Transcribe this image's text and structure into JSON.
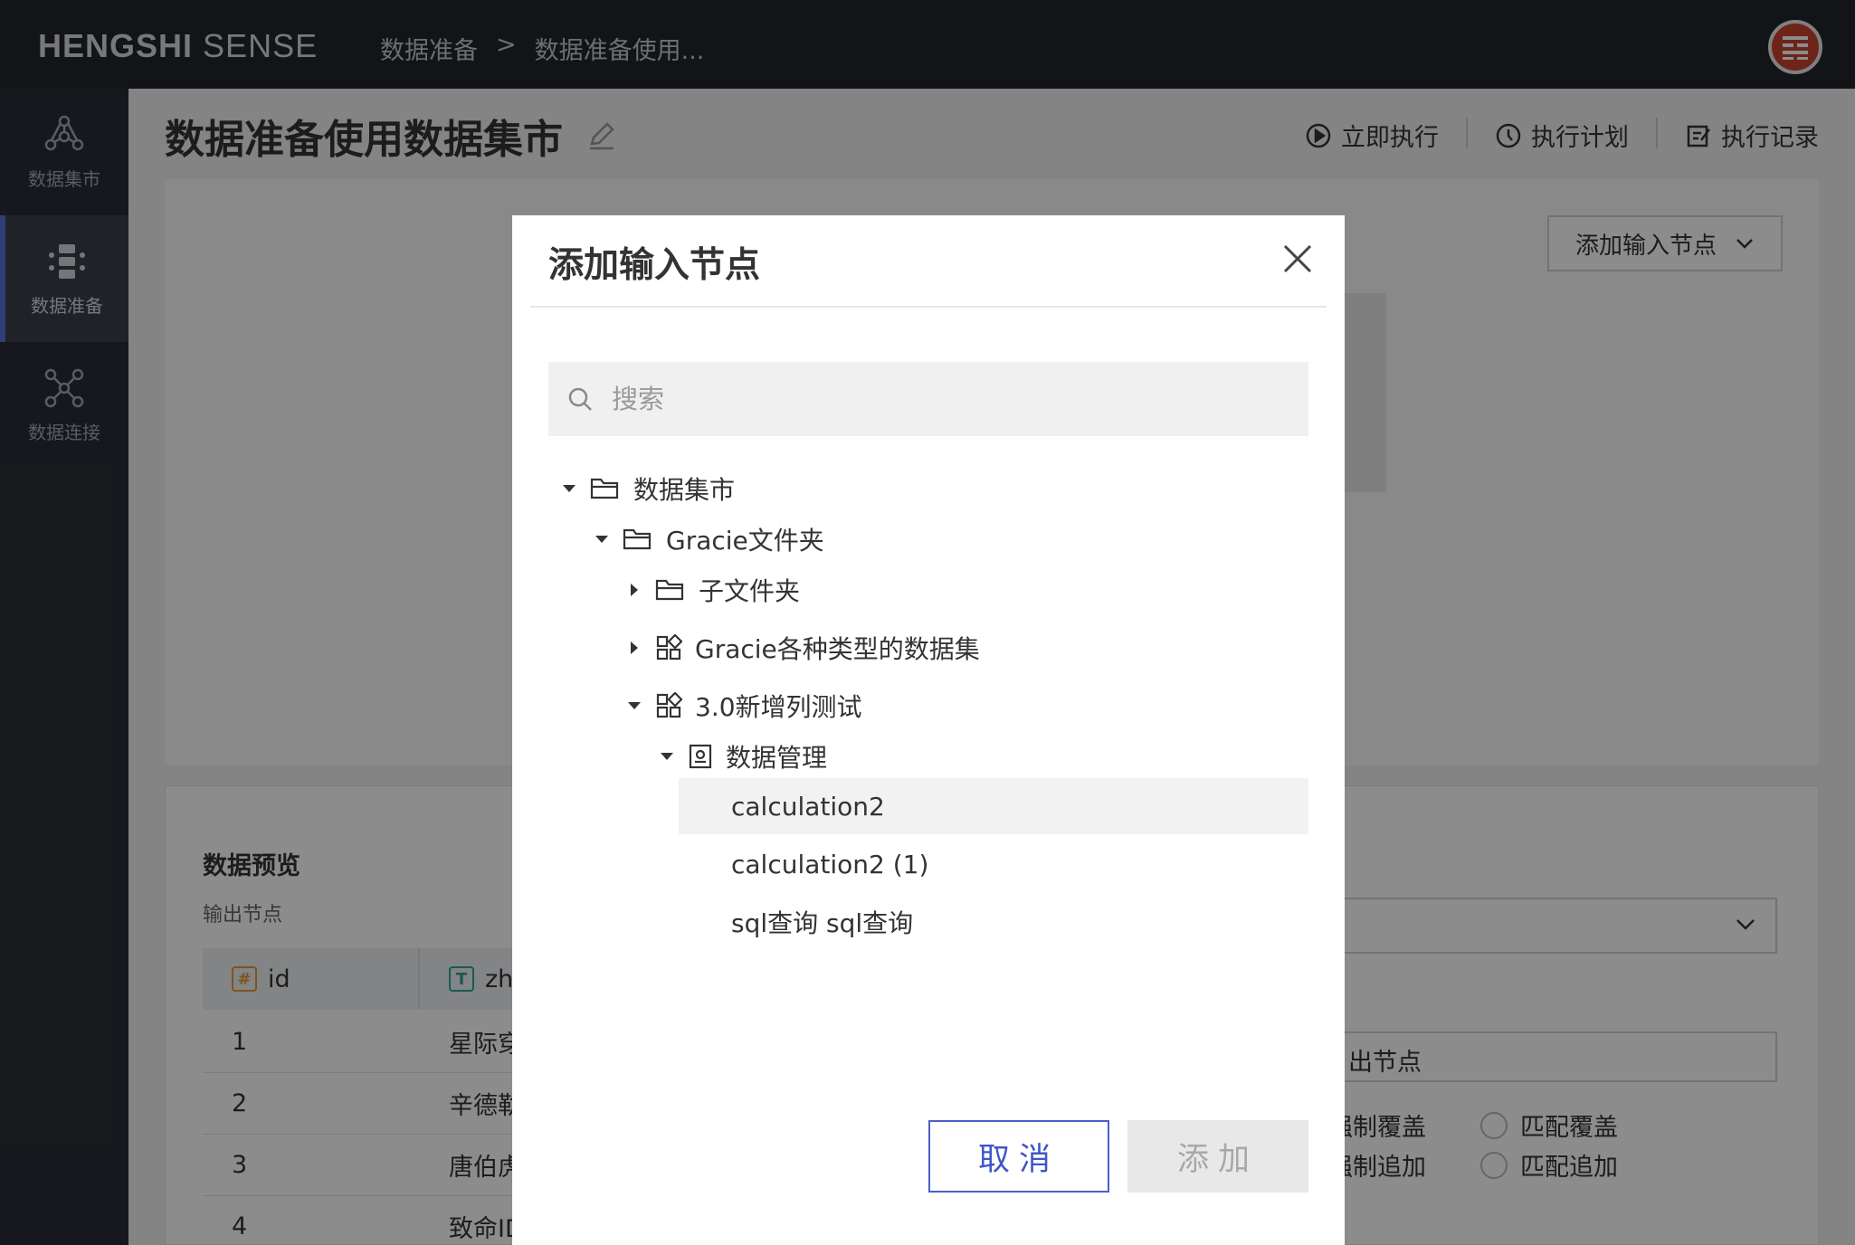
{
  "header": {
    "brand_bold": "HENGSHI",
    "brand_light": "SENSE",
    "breadcrumb": [
      "数据准备",
      ">",
      "数据准备使用..."
    ],
    "avatar_icon": "hengshi-logo-icon"
  },
  "sidebar": {
    "items": [
      {
        "label": "数据集市",
        "icon": "data-mart-icon",
        "active": false
      },
      {
        "label": "数据准备",
        "icon": "data-prep-icon",
        "active": true
      },
      {
        "label": "数据连接",
        "icon": "data-connect-icon",
        "active": false
      }
    ]
  },
  "page": {
    "title": "数据准备使用数据集市",
    "actions": [
      "立即执行",
      "执行计划",
      "执行记录"
    ],
    "add_input_node": "添加输入节点"
  },
  "preview": {
    "title": "数据预览",
    "subtitle": "输出节点",
    "columns": [
      {
        "label": "id",
        "type": "#"
      },
      {
        "label": "zh",
        "type": "T"
      }
    ],
    "rows": [
      {
        "id": "1",
        "zh": "星际穿"
      },
      {
        "id": "2",
        "zh": "辛德勒"
      },
      {
        "id": "3",
        "zh": "唐伯虎"
      },
      {
        "id": "4",
        "zh": "致命ID"
      }
    ]
  },
  "right_panel": {
    "output_node_text": "出节点",
    "radio_options": [
      "强制覆盖",
      "匹配覆盖",
      "强制追加",
      "匹配追加"
    ]
  },
  "modal": {
    "title": "添加输入节点",
    "search_placeholder": "搜索",
    "tree": [
      {
        "label": "数据集市",
        "level": 0,
        "expanded": true,
        "icon": "folder-icon"
      },
      {
        "label": "Gracie文件夹",
        "level": 1,
        "expanded": true,
        "icon": "folder-icon"
      },
      {
        "label": "子文件夹",
        "level": 2,
        "expanded": false,
        "icon": "folder-icon"
      },
      {
        "label": "Gracie各种类型的数据集",
        "level": 2,
        "expanded": false,
        "icon": "app-grid-icon"
      },
      {
        "label": "3.0新增列测试",
        "level": 2,
        "expanded": true,
        "icon": "app-grid-icon"
      },
      {
        "label": "数据管理",
        "level": 3,
        "expanded": true,
        "icon": "dataset-icon"
      }
    ],
    "leaves": [
      "calculation2",
      "calculation2 (1)",
      "sql查询 sql查询"
    ],
    "cancel_label": "取消",
    "add_label": "添加"
  },
  "colors": {
    "primary": "#3f56c8",
    "topbar": "#23252c",
    "sidebar": "#2b2d35"
  }
}
